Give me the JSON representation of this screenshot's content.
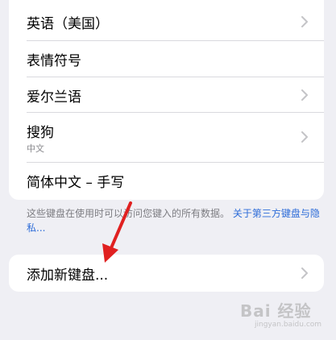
{
  "keyboards": [
    {
      "label": "英语（美国）",
      "sublabel": null,
      "chevron": true
    },
    {
      "label": "表情符号",
      "sublabel": null,
      "chevron": false
    },
    {
      "label": "爱尔兰语",
      "sublabel": null,
      "chevron": true
    },
    {
      "label": "搜狗",
      "sublabel": "中文",
      "chevron": true
    },
    {
      "label": "简体中文 – 手写",
      "sublabel": null,
      "chevron": false
    }
  ],
  "footer": {
    "text": "这些键盘在使用时可以访问您键入的所有数据。",
    "link": "关于第三方键盘与隐私..."
  },
  "add_keyboard": {
    "label": "添加新键盘..."
  },
  "watermark": {
    "text": "Bai 经验",
    "url": "jingyan.baidu.com"
  },
  "colors": {
    "background": "#efeff4",
    "link": "#2d6cd8",
    "arrow": "#e02020",
    "chevron": "#c4c4c7"
  },
  "icons": {
    "chevron": "chevron-right-icon",
    "arrow": "red-arrow-annotation"
  }
}
